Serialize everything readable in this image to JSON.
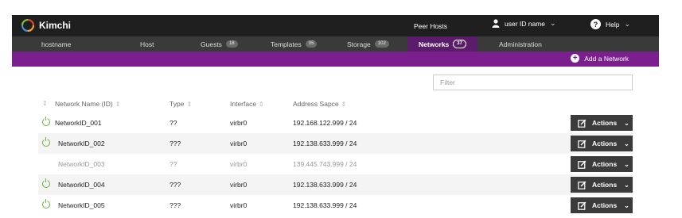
{
  "app": {
    "title": "Kimchi"
  },
  "topbar": {
    "peer_hosts": "Peer Hosts",
    "user_name": "user ID name",
    "help": "Help"
  },
  "tabs": [
    {
      "label": "hostname",
      "count": null,
      "active": false
    },
    {
      "label": "Host",
      "count": null,
      "active": false
    },
    {
      "label": "Guests",
      "count": "18",
      "active": false
    },
    {
      "label": "Templates",
      "count": "05",
      "active": false
    },
    {
      "label": "Storage",
      "count": "102",
      "active": false
    },
    {
      "label": "Networks",
      "count": "37",
      "active": true
    },
    {
      "label": "Administration",
      "count": null,
      "active": false
    }
  ],
  "toolbar": {
    "add_network": "Add a Network"
  },
  "filter": {
    "placeholder": "Filter",
    "value": ""
  },
  "table": {
    "columns": [
      "Network Name (ID)",
      "Type",
      "Interface",
      "Address Sapce"
    ],
    "rows": [
      {
        "name": "NetworkID_001",
        "type": "??",
        "interface": "virbr0",
        "address": "192.168.122.999 / 24",
        "active": true
      },
      {
        "name": "NetworkID_002",
        "type": "???",
        "interface": "virbr0",
        "address": "192.138.633.999 / 24",
        "active": true
      },
      {
        "name": "NetworkID_003",
        "type": "??",
        "interface": "virbr0",
        "address": "139.445.743.999 / 24",
        "active": false
      },
      {
        "name": "NetworkID_004",
        "type": "???",
        "interface": "virbr0",
        "address": "192.138.633.999 / 24",
        "active": true
      },
      {
        "name": "NetworkID_005",
        "type": "???",
        "interface": "virbr0",
        "address": "192.138.633.999 / 24",
        "active": true
      }
    ],
    "action_label": "Actions"
  }
}
